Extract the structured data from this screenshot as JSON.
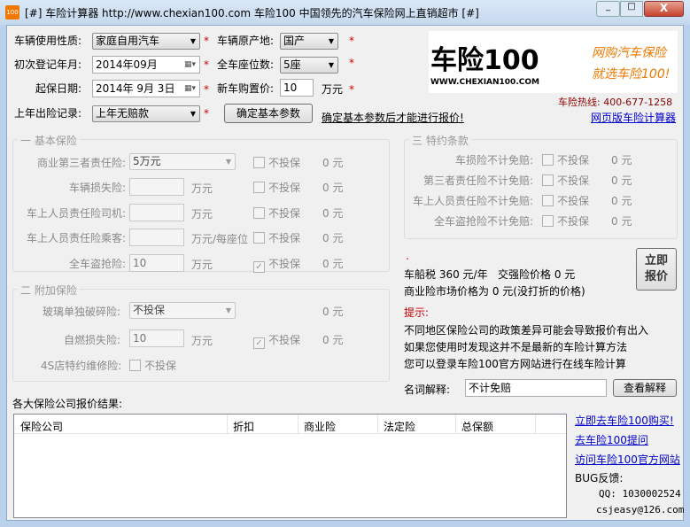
{
  "window": {
    "title": "[#] 车险计算器 http://www.chexian100.com 车险100 中国领先的汽车保险网上直销超市 [#]",
    "app_icon": "100",
    "min": "minimize-icon",
    "max": "maximize-icon",
    "close": "close-icon"
  },
  "form": {
    "usage_label": "车辆使用性质:",
    "usage_value": "家庭自用汽车",
    "origin_label": "车辆原产地:",
    "origin_value": "国产",
    "reg_label": "初次登记年月:",
    "reg_value": "2014年09月",
    "seats_label": "全车座位数:",
    "seats_value": "5座",
    "start_label": "起保日期:",
    "start_value": "2014年 9月 3日",
    "price_label": "新车购置价:",
    "price_value": "10",
    "price_unit": "万元",
    "history_label": "上年出险记录:",
    "history_value": "上年无赔款",
    "confirm_button": "确定基本参数",
    "confirm_hint": "确定基本参数后才能进行报价!",
    "star": "*"
  },
  "ad": {
    "logo_text": "车险100",
    "logo_url": "WWW.CHEXIAN100.COM",
    "slogan1": "网购汽车保险",
    "slogan2": "就选车险100!",
    "hotline": "车险热线: 400-677-1258",
    "web_link": "网页版车险计算器"
  },
  "basic": {
    "title": "一 基本保险",
    "rows": [
      {
        "label": "商业第三者责任险:",
        "value": "5万元",
        "unit": "",
        "check": "不投保",
        "checked": false,
        "price": "0 元"
      },
      {
        "label": "车辆损失险:",
        "value": "",
        "unit": "万元",
        "check": "不投保",
        "checked": false,
        "price": "0 元"
      },
      {
        "label": "车上人员责任险司机:",
        "value": "",
        "unit": "万元",
        "check": "不投保",
        "checked": false,
        "price": "0 元"
      },
      {
        "label": "车上人员责任险乘客:",
        "value": "",
        "unit": "万元/每座位",
        "check": "不投保",
        "checked": false,
        "price": "0 元"
      },
      {
        "label": "全车盗抢险:",
        "value": "10",
        "unit": "万元",
        "check": "不投保",
        "checked": true,
        "price": "0 元"
      }
    ]
  },
  "addon": {
    "title": "二 附加保险",
    "glass_label": "玻璃单独破碎险:",
    "glass_value": "不投保",
    "glass_price": "0 元",
    "fire_label": "自燃损失险:",
    "fire_value": "10",
    "fire_unit": "万元",
    "fire_check": "不投保",
    "fire_price": "0 元",
    "shop_label": "4S店特约维修险:",
    "shop_check": "不投保"
  },
  "special": {
    "title": "三 特约条款",
    "rows": [
      {
        "label": "车损险不计免赔:",
        "check": "不投保",
        "price": "0 元"
      },
      {
        "label": "第三者责任险不计免赔:",
        "check": "不投保",
        "price": "0 元"
      },
      {
        "label": "车上人员责任险不计免赔:",
        "check": "不投保",
        "price": "0 元"
      },
      {
        "label": "全车盗抢险不计免赔:",
        "check": "不投保",
        "price": "0 元"
      }
    ]
  },
  "summary": {
    "dot": ".",
    "line1": "车船税 360 元/年   交强险价格 0 元",
    "line2": "商业险市场价格为 0 元(没打折的价格)",
    "quote_button": "立即\n报价",
    "tip_title": "提示:",
    "tips": [
      "不同地区保险公司的政策差异可能会导致报价有出入",
      "如果您使用时发现这并不是最新的车险计算方法",
      "您可以登录车险100官方网站进行在线车险计算"
    ],
    "term_label": "名词解释:",
    "term_value": "不计免赔",
    "term_button": "查看解释"
  },
  "results": {
    "title": "各大保险公司报价结果:",
    "columns": [
      "保险公司",
      "折扣",
      "商业险",
      "法定险",
      "总保额"
    ]
  },
  "links": {
    "buy": "立即去车险100购买!",
    "ask": "去车险100提问",
    "visit": "访问车险100官方网站",
    "bug": "BUG反馈:",
    "qq": "QQ: 1030002524",
    "email": "csjeasy@126.com"
  },
  "colors": {
    "accent_red": "#cc0000",
    "link": "#0000cc",
    "logo_orange": "#f07800"
  }
}
